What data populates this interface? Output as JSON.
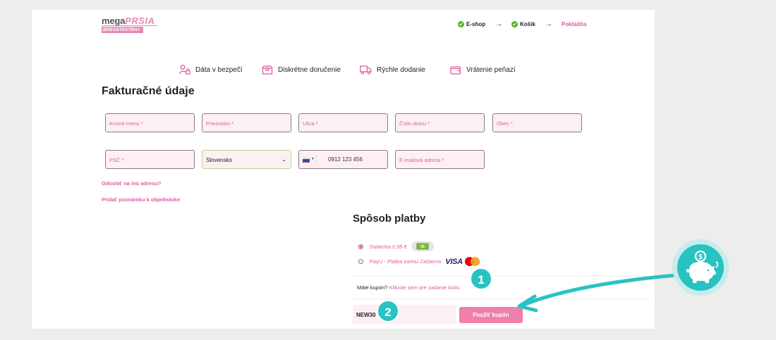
{
  "logo": {
    "word_a": "mega",
    "word_b": "PRSIA",
    "badge": "BREASTEXTRA+"
  },
  "steps": [
    {
      "label": "E-shop",
      "state": "done"
    },
    {
      "label": "Košík",
      "state": "done"
    },
    {
      "label": "Pokladňa",
      "state": "active"
    }
  ],
  "features": [
    {
      "icon": "person-lock-icon",
      "label": "Dáta v bezpečí"
    },
    {
      "icon": "package-icon",
      "label": "Diskrétne doručenie"
    },
    {
      "icon": "truck-icon",
      "label": "Rýchle dodanie"
    },
    {
      "icon": "wallet-icon",
      "label": "Vrátenie peňazí"
    }
  ],
  "billing": {
    "title": "Fakturačné údaje",
    "first_name": "Krstné meno",
    "last_name": "Priezvisko",
    "street": "Ulica",
    "house_number": "Číslo domu",
    "city": "Obec",
    "zip": "PSČ",
    "country": "Slovensko",
    "phone": "0912 123 456",
    "email": "E-mailová adresa",
    "required_mark": "*"
  },
  "links": {
    "other_address": "Odoslať na inú adresu?",
    "order_note": "Pridať poznámku k objednávke"
  },
  "payment": {
    "title": "Spôsob platby",
    "options": [
      {
        "label": "Dobierka 0,95 €",
        "selected": true
      },
      {
        "label": "PayU - Platba kartou Zadarmo",
        "selected": false
      }
    ],
    "visa": "VISA"
  },
  "coupon": {
    "question": "Máte kupón?",
    "link": "Kliknite sem pre zadanie kódu",
    "value": "NEW30",
    "button": "Použiť kupón"
  },
  "annotations": {
    "badge1": "1",
    "badge2": "2"
  },
  "colors": {
    "accent": "#e05a9f",
    "teal": "#28c2c2",
    "field_bg": "#fdf0f4"
  }
}
